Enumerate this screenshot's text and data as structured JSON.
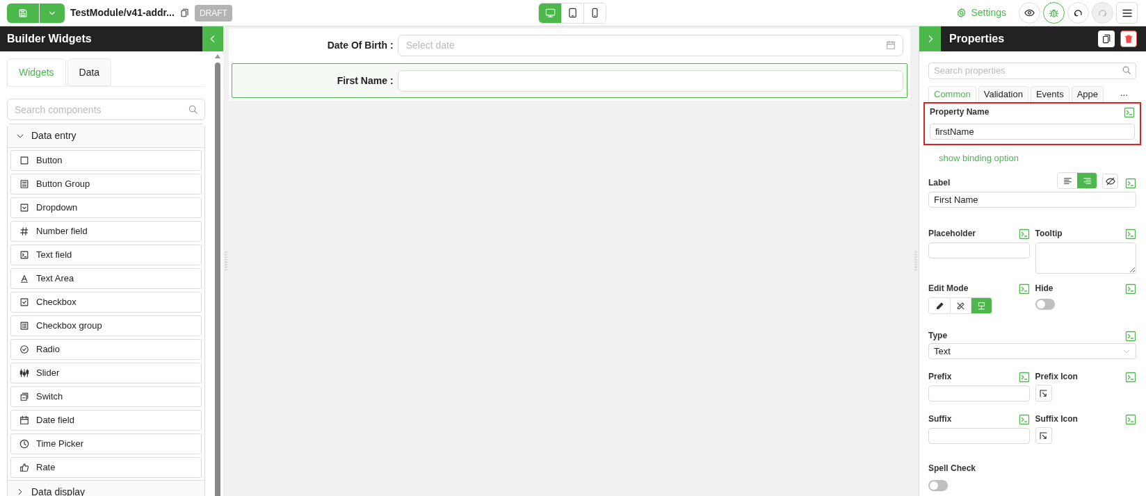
{
  "toolbar": {
    "title": "TestModule/v41-addr...",
    "status": "DRAFT",
    "devices": [
      {
        "kind": "desktop",
        "selected": true
      },
      {
        "kind": "tablet",
        "selected": false
      },
      {
        "kind": "phone",
        "selected": false
      }
    ],
    "settings": "Settings",
    "actions": [
      {
        "kind": "preview",
        "active": false,
        "disabled": false
      },
      {
        "kind": "debug",
        "active": true,
        "disabled": false
      },
      {
        "kind": "undo",
        "active": false,
        "disabled": false
      },
      {
        "kind": "redo",
        "active": false,
        "disabled": true
      }
    ]
  },
  "sidebar": {
    "title": "Builder Widgets",
    "tabs": [
      {
        "label": "Widgets",
        "selected": true
      },
      {
        "label": "Data",
        "selected": false
      }
    ],
    "search": {
      "placeholder": "Search components"
    },
    "groups": [
      {
        "label": "Data entry",
        "expanded": true,
        "items": [
          {
            "label": "Button",
            "kind": "button"
          },
          {
            "label": "Button Group",
            "kind": "button-group"
          },
          {
            "label": "Dropdown",
            "kind": "dropdown"
          },
          {
            "label": "Number field",
            "kind": "number"
          },
          {
            "label": "Text field",
            "kind": "text"
          },
          {
            "label": "Text Area",
            "kind": "textarea"
          },
          {
            "label": "Checkbox",
            "kind": "checkbox"
          },
          {
            "label": "Checkbox group",
            "kind": "checkbox-group"
          },
          {
            "label": "Radio",
            "kind": "radio"
          },
          {
            "label": "Slider",
            "kind": "slider"
          },
          {
            "label": "Switch",
            "kind": "switch"
          },
          {
            "label": "Date field",
            "kind": "date"
          },
          {
            "label": "Time Picker",
            "kind": "time"
          },
          {
            "label": "Rate",
            "kind": "rate"
          }
        ]
      },
      {
        "label": "Data display",
        "expanded": false
      }
    ]
  },
  "canvas": {
    "fields": [
      {
        "label": "Date Of Birth",
        "colon": ":",
        "kind": "date",
        "placeholder": "Select date",
        "selected": false
      },
      {
        "label": "First Name",
        "colon": ":",
        "kind": "text",
        "selected": true
      }
    ]
  },
  "properties": {
    "title": "Properties",
    "search": {
      "placeholder": "Search properties"
    },
    "tabs": [
      {
        "label": "Common",
        "selected": true
      },
      {
        "label": "Validation",
        "selected": false
      },
      {
        "label": "Events",
        "selected": false
      },
      {
        "label": "Appe",
        "selected": false
      }
    ],
    "more": "...",
    "property_name": {
      "label": "Property Name",
      "value": "firstName",
      "highlighted": true
    },
    "binding_link": "show binding option",
    "label": {
      "label": "Label",
      "value": "First Name",
      "alignment": [
        {
          "kind": "left",
          "selected": false
        },
        {
          "kind": "right",
          "selected": true
        }
      ]
    },
    "placeholder_field": {
      "label": "Placeholder"
    },
    "tooltip": {
      "label": "Tooltip"
    },
    "edit_mode": {
      "label": "Edit Mode",
      "options": [
        {
          "kind": "edit",
          "selected": false
        },
        {
          "kind": "readonly",
          "selected": false
        },
        {
          "kind": "inherit",
          "selected": true
        }
      ]
    },
    "hide": {
      "label": "Hide",
      "on": false
    },
    "type": {
      "label": "Type",
      "value": "Text"
    },
    "prefix": {
      "label": "Prefix"
    },
    "prefix_icon": {
      "label": "Prefix Icon"
    },
    "suffix": {
      "label": "Suffix"
    },
    "suffix_icon": {
      "label": "Suffix Icon"
    },
    "spell_check": {
      "label": "Spell Check",
      "on": false
    }
  }
}
